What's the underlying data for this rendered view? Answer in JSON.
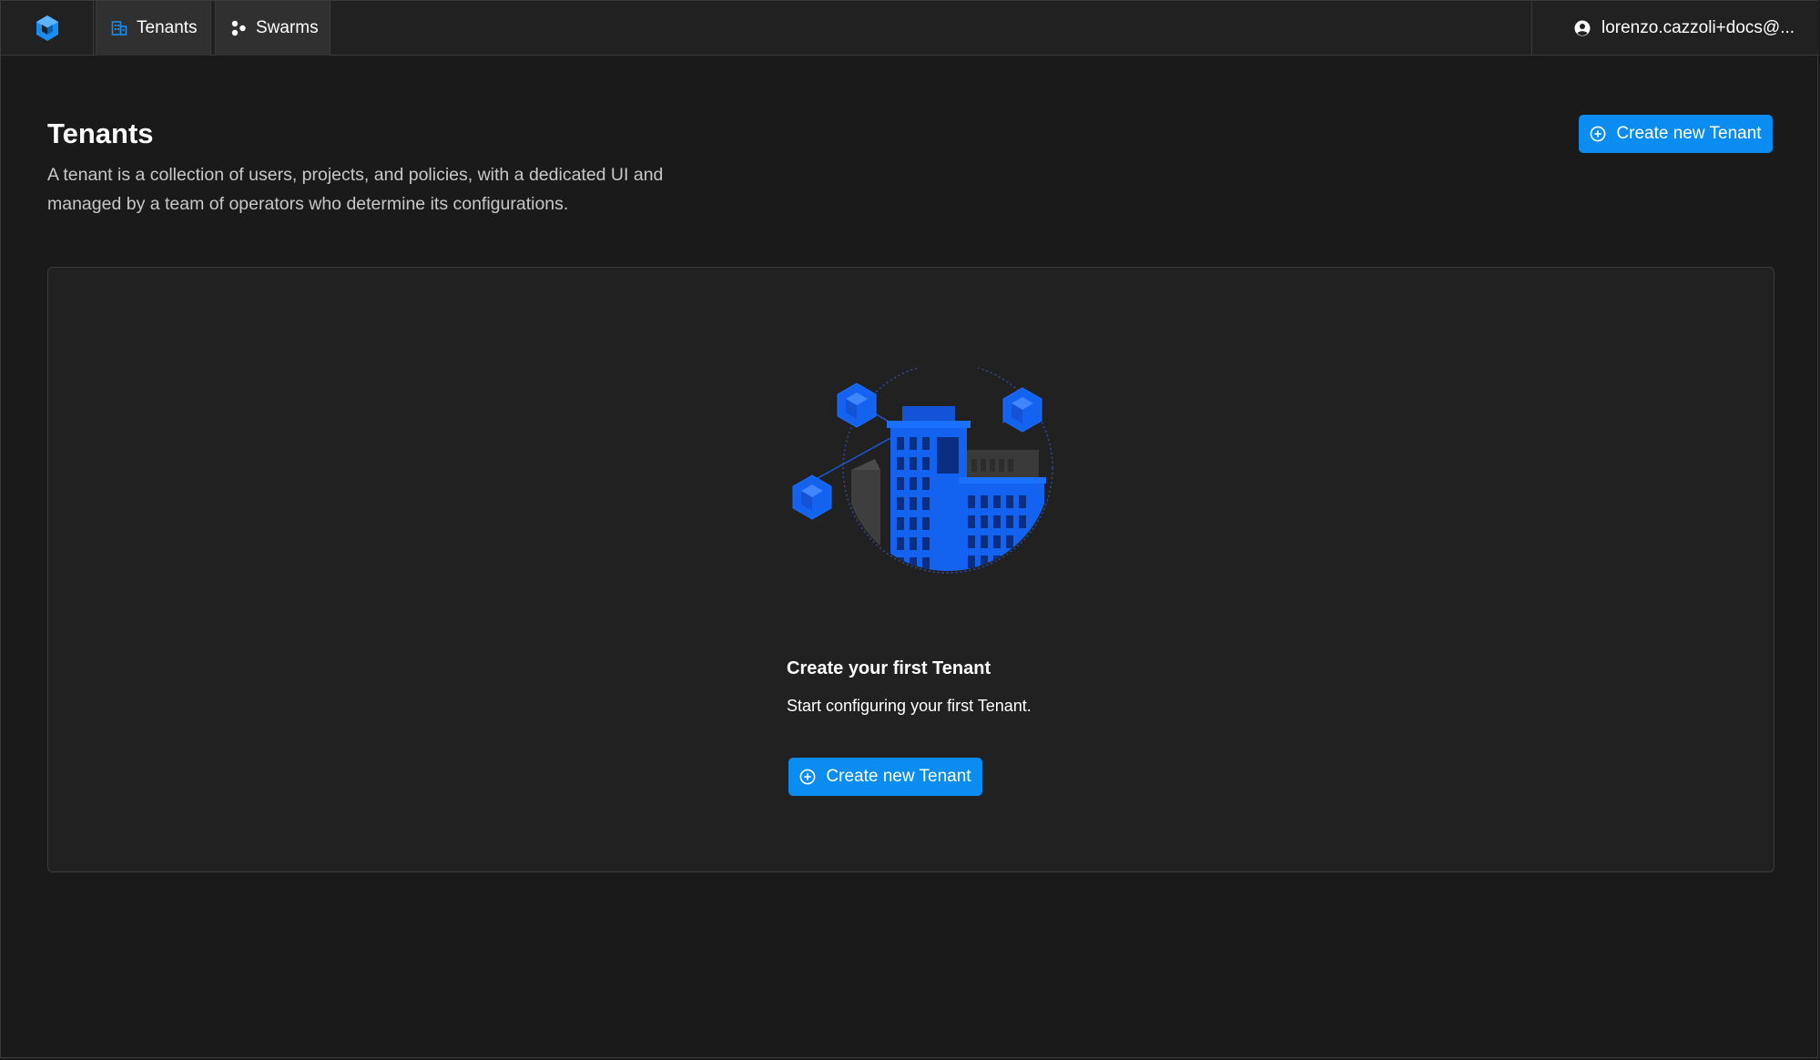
{
  "topbar": {
    "logo_icon": "cube-logo-icon",
    "tabs": [
      {
        "label": "Tenants",
        "icon": "building-icon"
      },
      {
        "label": "Swarms",
        "icon": "swarm-nodes-icon"
      }
    ],
    "user": {
      "label": "lorenzo.cazzoli+docs@...",
      "icon": "user-circle-icon"
    }
  },
  "header": {
    "title": "Tenants",
    "description": "A tenant is a collection of users, projects, and policies, with a dedicated UI and managed by a team of operators who determine its configurations.",
    "create_button": "Create new Tenant"
  },
  "empty_state": {
    "illustration": "tenant-building-illustration",
    "title": "Create your first Tenant",
    "subtitle": "Start configuring your first Tenant.",
    "create_button": "Create new Tenant"
  },
  "colors": {
    "accent": "#0a8cf0",
    "illustration_blue": "#1463f0",
    "background": "#1a1a1a",
    "surface": "#212121"
  }
}
